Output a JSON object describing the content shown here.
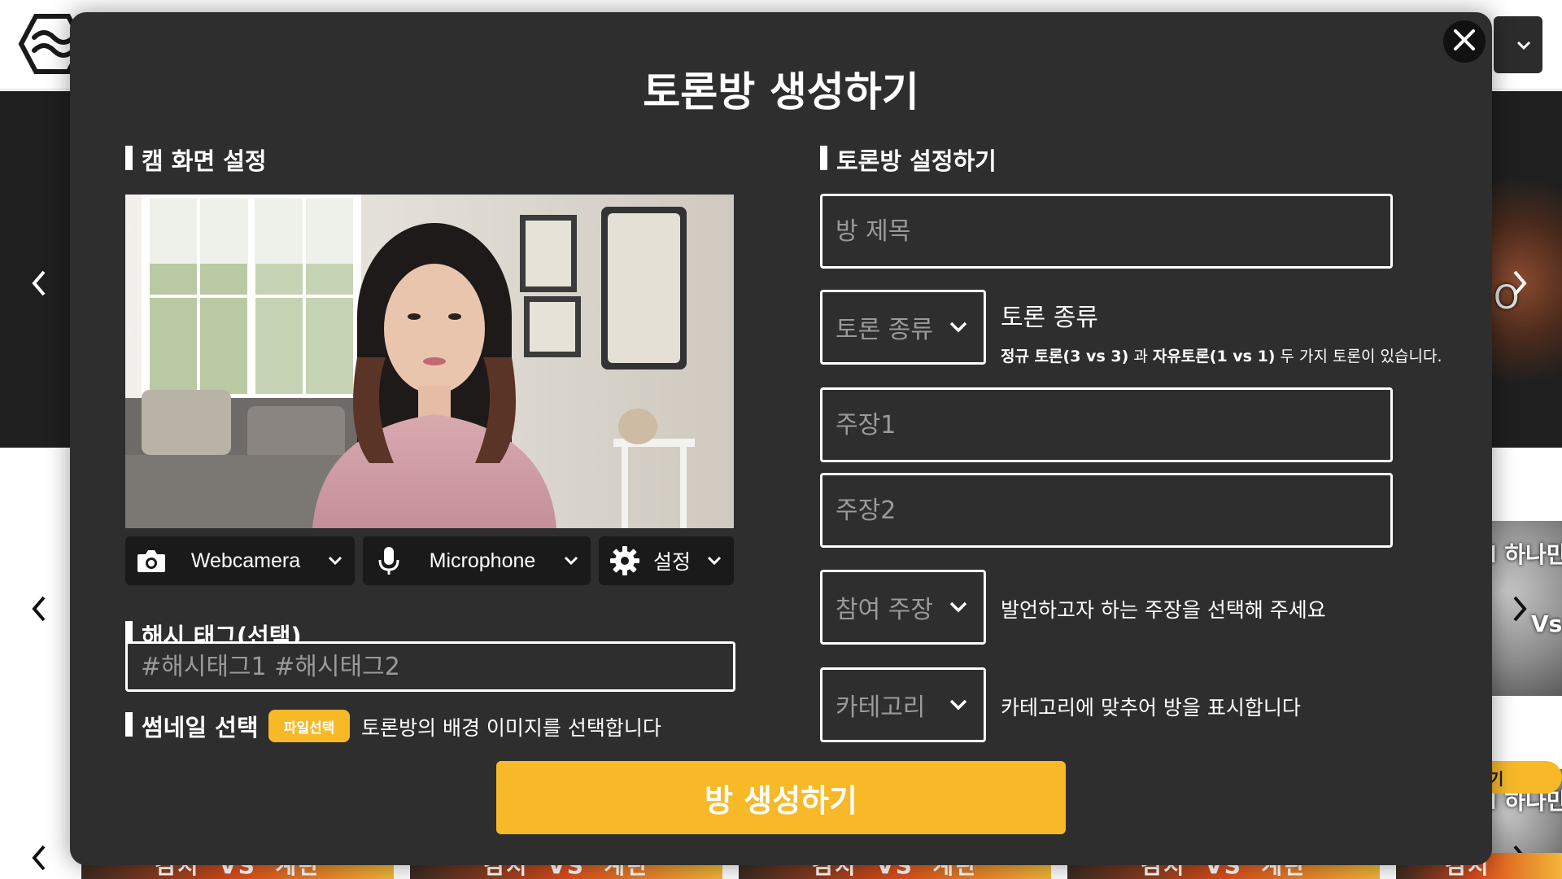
{
  "background": {
    "user_dropdown_chevron": "⌄",
    "banner_partial_text": "O",
    "card1_text": "l 하나만",
    "card1_vs": "Vs",
    "card2_text": "l 하나만",
    "card2_vs": "Vs",
    "yellow_pill_text": "기",
    "tiles": [
      {
        "left": "김치",
        "vs": "VS",
        "right": "계란"
      },
      {
        "left": "김치",
        "vs": "VS",
        "right": "계란"
      },
      {
        "left": "김치",
        "vs": "VS",
        "right": "계란"
      },
      {
        "left": "김치",
        "vs": "VS",
        "right": "계란"
      },
      {
        "left": "김치",
        "vs": ""
      }
    ]
  },
  "modal": {
    "title": "토론방 생성하기",
    "cam_section": {
      "title": "캠 화면 설정",
      "webcam_label": "Webcamera",
      "mic_label": "Microphone",
      "settings_label": "설정"
    },
    "hashtag": {
      "title": "해시 태그(선택)",
      "placeholder": "#해시태그1 #해시태그2",
      "value": ""
    },
    "thumbnail": {
      "title": "썸네일 선택",
      "file_button": "파일선택",
      "description": "토론방의 배경 이미지를 선택합니다"
    },
    "room_settings": {
      "title": "토론방 설정하기",
      "room_title_placeholder": "방 제목",
      "debate_type_select": "토론 종류",
      "debate_type_title": "토론 종류",
      "debate_type_desc": {
        "part1": "정규 토론(3 vs 3)",
        "part2": " 과 ",
        "part3": "자유토론(1 vs 1)",
        "part4": " 두 가지 토론이 있습니다."
      },
      "claim1_placeholder": "주장1",
      "claim2_placeholder": "주장2",
      "join_claim_select": "참여 주장",
      "join_claim_desc": "발언하고자 하는 주장을 선택해 주세요",
      "category_select": "카테고리",
      "category_desc": "카테고리에 맞추어 방을 표시합니다"
    },
    "create_button": "방 생성하기"
  },
  "colors": {
    "modal_bg": "#2e2e2e",
    "accent_yellow": "#f7b928",
    "dropdown_bg": "#1a1a1a"
  },
  "icons": [
    "logo-icon",
    "close-icon",
    "camera-icon",
    "microphone-icon",
    "gear-icon",
    "chevron-down-icon",
    "chevron-left-icon",
    "chevron-right-icon"
  ]
}
